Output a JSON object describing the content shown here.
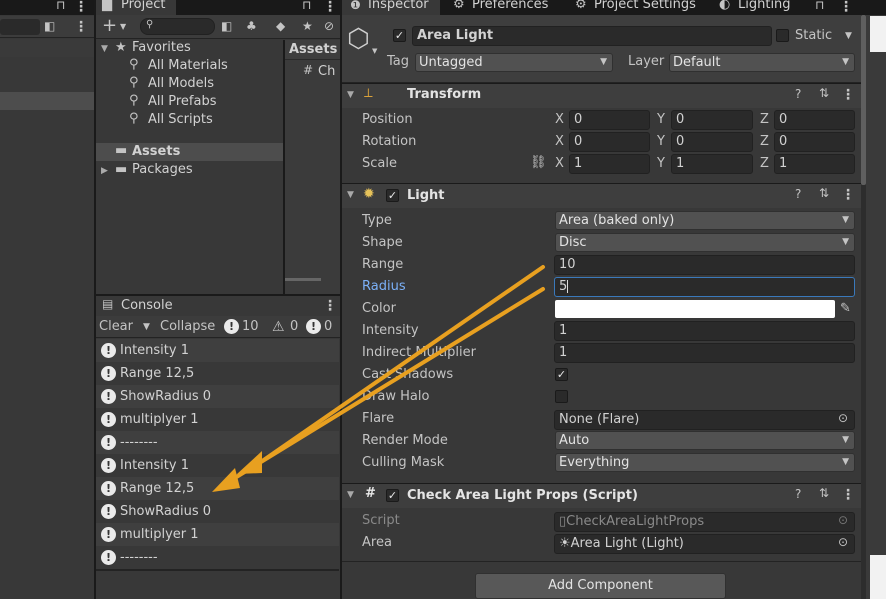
{
  "hierarchy": {},
  "project": {
    "tab": "Project",
    "search_placeholder": "",
    "favorites_label": "Favorites",
    "favorites": [
      "All Materials",
      "All Models",
      "All Prefabs",
      "All Scripts"
    ],
    "assets_label": "Assets",
    "packages_label": "Packages",
    "assets_header": "Assets",
    "asset_item": "Ch"
  },
  "console": {
    "tab": "Console",
    "clear": "Clear",
    "collapse": "Collapse",
    "count_info": "10",
    "count_warn": "0",
    "count_error": "0",
    "rows": [
      "Intensity  1",
      "Range  12,5",
      "ShowRadius  0",
      "multiplyer 1",
      "--------",
      "Intensity  1",
      "Range  12,5",
      "ShowRadius  0",
      "multiplyer 1",
      "--------"
    ]
  },
  "inspector": {
    "tabs": [
      "Inspector",
      "Preferences",
      "Project Settings",
      "Lighting"
    ],
    "object_name": "Area Light",
    "static_label": "Static",
    "tag_label": "Tag",
    "tag_value": "Untagged",
    "layer_label": "Layer",
    "layer_value": "Default",
    "transform": {
      "title": "Transform",
      "position_label": "Position",
      "rotation_label": "Rotation",
      "scale_label": "Scale",
      "axis_x": "X",
      "axis_y": "Y",
      "axis_z": "Z",
      "position": [
        "0",
        "0",
        "0"
      ],
      "rotation": [
        "0",
        "0",
        "0"
      ],
      "scale": [
        "1",
        "1",
        "1"
      ]
    },
    "light": {
      "title": "Light",
      "type_label": "Type",
      "type_value": "Area (baked only)",
      "shape_label": "Shape",
      "shape_value": "Disc",
      "range_label": "Range",
      "range_value": "10",
      "radius_label": "Radius",
      "radius_value": "5",
      "color_label": "Color",
      "color_value": "#ffffff",
      "intensity_label": "Intensity",
      "intensity_value": "1",
      "indirect_label": "Indirect Multiplier",
      "indirect_value": "1",
      "shadows_label": "Cast Shadows",
      "shadows_checked": true,
      "halo_label": "Draw Halo",
      "halo_checked": false,
      "flare_label": "Flare",
      "flare_value": "None (Flare)",
      "render_label": "Render Mode",
      "render_value": "Auto",
      "culling_label": "Culling Mask",
      "culling_value": "Everything"
    },
    "script": {
      "title": "Check Area Light Props (Script)",
      "script_label": "Script",
      "script_value": "CheckAreaLightProps",
      "area_label": "Area",
      "area_value": "Area Light (Light)"
    },
    "add_component": "Add Component"
  },
  "colors": {
    "accent_label": "#7bb0f7",
    "arrow": "#e8a020"
  }
}
